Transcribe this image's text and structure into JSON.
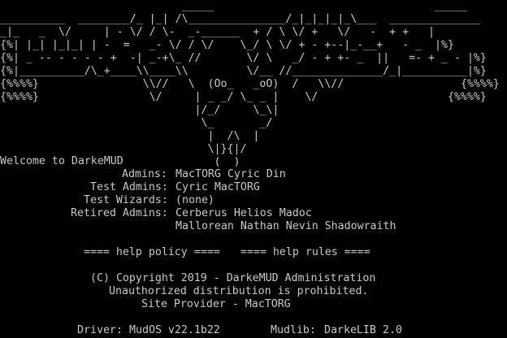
{
  "banner_art": "                            _____                                  _____\n__________  ________/_ |_| /\\_______________/_|_|_|_|_\\___  ______________\n_|_   _  \\/     | - \\/ / \\-  _-______  + / \\ \\/ +   \\/   -  + +   |\n{%| |_| |_|_| | -  =   _- \\/ / \\/    \\_/ \\ \\/ + - +--|_-__+   - _  |%}\n{%| _ -- - - - - +  -| _-+\\_ //       \\/ \\   _/ - + +- _  ||   =- + _ - |%}\n{%|__________/\\_+____\\\\____\\\\         \\/__ //______________/_|__________|%}\n{%%%%}                \\\\//   \\  (Oo_   _oO)  /   \\\\//                  {%%%%}\n{%%%%}                 \\/     | _ _/ \\_ _ |    \\/                    {%%%%}\n                              |/_/     \\_\\|\n                               \\_       _/\n                                |  /\\  |\n                                \\|}{|/\n                                 (  )",
  "welcome": "Welcome to DarkeMUD",
  "staff": [
    {
      "label": "Admins:",
      "value": "MacTORG Cyric Din"
    },
    {
      "label": "Test Admins:",
      "value": "Cyric MacTORG"
    },
    {
      "label": "Test Wizards:",
      "value": "(none)"
    },
    {
      "label": "Retired Admins:",
      "value": "Cerberus Helios Madoc"
    }
  ],
  "retired_admins_cont": "Mallorean Nathan Nevin Shadowraith",
  "help_policy": "==== help policy ====",
  "help_rules": "==== help rules ====",
  "copyright": "(C) Copyright 2019 - DarkeMUD Administration",
  "unauthorized": "Unauthorized distribution is prohibited.",
  "site_provider": "Site Provider - MacTORG",
  "driver_label": "Driver:",
  "driver_value": "MudOS v22.1b22",
  "mudlib_label": "Mudlib:",
  "mudlib_value": "DarkeLIB 2.0"
}
